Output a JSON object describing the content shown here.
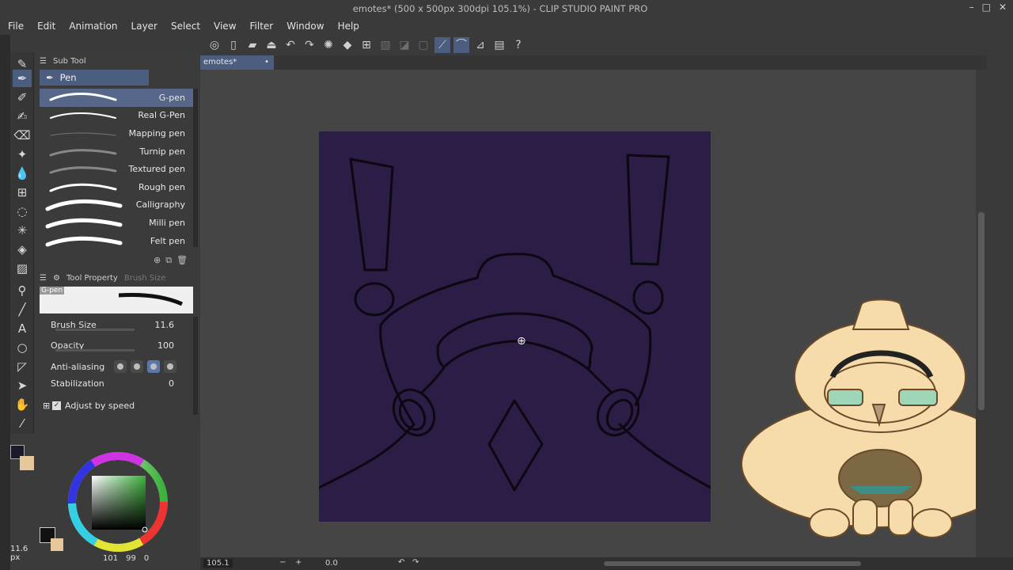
{
  "window": {
    "title": "emotes* (500 x 500px 300dpi 105.1%) - CLIP STUDIO PAINT PRO",
    "controls": [
      "–",
      "□",
      "✕"
    ]
  },
  "menu": [
    "File",
    "Edit",
    "Animation",
    "Layer",
    "Select",
    "View",
    "Filter",
    "Window",
    "Help"
  ],
  "subtool_panel": {
    "header": "Sub Tool",
    "group": "Pen",
    "brushes": [
      {
        "label": "G-pen",
        "selected": true
      },
      {
        "label": "Real G-Pen",
        "selected": false
      },
      {
        "label": "Mapping pen",
        "selected": false
      },
      {
        "label": "Turnip pen",
        "selected": false
      },
      {
        "label": "Textured pen",
        "selected": false
      },
      {
        "label": "Rough pen",
        "selected": false
      },
      {
        "label": "Calligraphy",
        "selected": false
      },
      {
        "label": "Milli pen",
        "selected": false
      },
      {
        "label": "Felt pen",
        "selected": false
      }
    ]
  },
  "tool_property": {
    "header": "Tool Property",
    "header2": "Brush Size",
    "preset_name": "G-pen",
    "brush_size_label": "Brush Size",
    "brush_size_value": "11.6",
    "opacity_label": "Opacity",
    "opacity_value": "100",
    "antialias_label": "Anti-aliasing",
    "stabilization_label": "Stabilization",
    "stabilization_value": "0",
    "adjust_by_speed_label": "Adjust by speed"
  },
  "document_tab": {
    "label": "emotes*"
  },
  "status": {
    "zoom": "105.1",
    "angle": "0.0",
    "hsv_h": "101",
    "hsv_s": "99",
    "hsv_v": "0",
    "brush_size_display": "11.6",
    "brush_unit": "px"
  },
  "colors": {
    "canvas_bg": "#2b1d45",
    "ui_accent": "#4b5e80",
    "mascot_fill": "#f6dcab",
    "glasses": "#9fd6b7"
  }
}
